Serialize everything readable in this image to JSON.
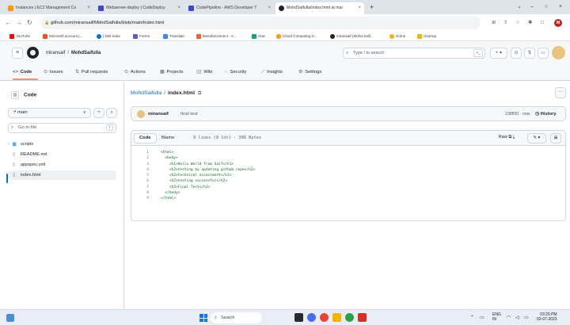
{
  "browser": {
    "tabs": [
      {
        "title": "Instances | EC2 Management Co",
        "icon": "aws-icon",
        "color": "#ff9900",
        "active": false
      },
      {
        "title": "Webserver-deploy | CodeDeploy",
        "icon": "aws-icon",
        "color": "#3b48cc",
        "active": false
      },
      {
        "title": "CodePipeline - AWS Developer T",
        "icon": "aws-icon",
        "color": "#3b48cc",
        "active": false
      },
      {
        "title": "MohdSaifulla/index.html at mai",
        "icon": "github-icon",
        "color": "#1f2328",
        "active": true
      }
    ],
    "new_tab": "+",
    "url": "github.com/miransaif/MohdSaifulla/blob/main/index.html",
    "bookmarks": [
      {
        "label": "YouTube",
        "color": "#ff0000"
      },
      {
        "label": "Microsoft account |...",
        "color": "#f25022"
      },
      {
        "label": "| Dell India",
        "color": "#0076ce"
      },
      {
        "label": "Forms",
        "color": "#5b5fc7"
      },
      {
        "label": "Translate",
        "color": "#4285f4"
      },
      {
        "label": "BarodaConnect - A...",
        "color": "#f26522"
      },
      {
        "label": "chat",
        "color": "#10a37f"
      },
      {
        "label": "Cloud Computing S...",
        "color": "#ff9900"
      },
      {
        "label": "miransaif (Mohd Saif)",
        "color": "#1f2328"
      },
      {
        "label": "Home",
        "color": "#f4b400"
      },
      {
        "label": "cleanup",
        "color": "#f4b400"
      }
    ],
    "profile_initial": "M"
  },
  "github": {
    "owner": "miransaif",
    "repo": "MohdSaifulla",
    "search_placeholder": "Type / to search",
    "repo_nav": [
      {
        "label": "Code",
        "icon": "code-icon",
        "active": true
      },
      {
        "label": "Issues",
        "icon": "issue-icon",
        "active": false
      },
      {
        "label": "Pull requests",
        "icon": "pull-request-icon",
        "active": false
      },
      {
        "label": "Actions",
        "icon": "actions-icon",
        "active": false
      },
      {
        "label": "Projects",
        "icon": "projects-icon",
        "active": false
      },
      {
        "label": "Wiki",
        "icon": "wiki-icon",
        "active": false
      },
      {
        "label": "Security",
        "icon": "shield-icon",
        "active": false
      },
      {
        "label": "Insights",
        "icon": "graph-icon",
        "active": false
      },
      {
        "label": "Settings",
        "icon": "gear-icon",
        "active": false
      }
    ],
    "sidebar": {
      "title": "Code",
      "branch": "main",
      "go_to_file": "Go to file",
      "shortcut": "t",
      "tree": [
        {
          "name": "scripts",
          "type": "folder"
        },
        {
          "name": "README.md",
          "type": "file"
        },
        {
          "name": "appspec.yml",
          "type": "file"
        },
        {
          "name": "index.html",
          "type": "file",
          "selected": true
        }
      ]
    },
    "file": {
      "repo": "MohdSaifulla",
      "name": "index.html",
      "commit": {
        "author": "miransaif",
        "message": "final test",
        "sha_time": "238ff30 · now",
        "history": "History"
      },
      "view_tabs": [
        "Code",
        "Blame"
      ],
      "meta": "9 lines (9 loc) · 306 Bytes",
      "raw": "Raw",
      "lines": [
        "<html>",
        "  <body>",
        "    <h1>Hello World from Saif</h1>",
        "    <h2>testing by updating github repo</h2>",
        "    <h2>technical assessment</h2>",
        "    <h2>testing successful</h2>",
        "    <h3>Final Test</h3>",
        "  </body>",
        "</html>"
      ]
    }
  },
  "taskbar": {
    "search": "Search",
    "tray": {
      "lang": "ENG",
      "region": "IN",
      "time": "03:20 PM",
      "date": "02-07-2023"
    }
  }
}
